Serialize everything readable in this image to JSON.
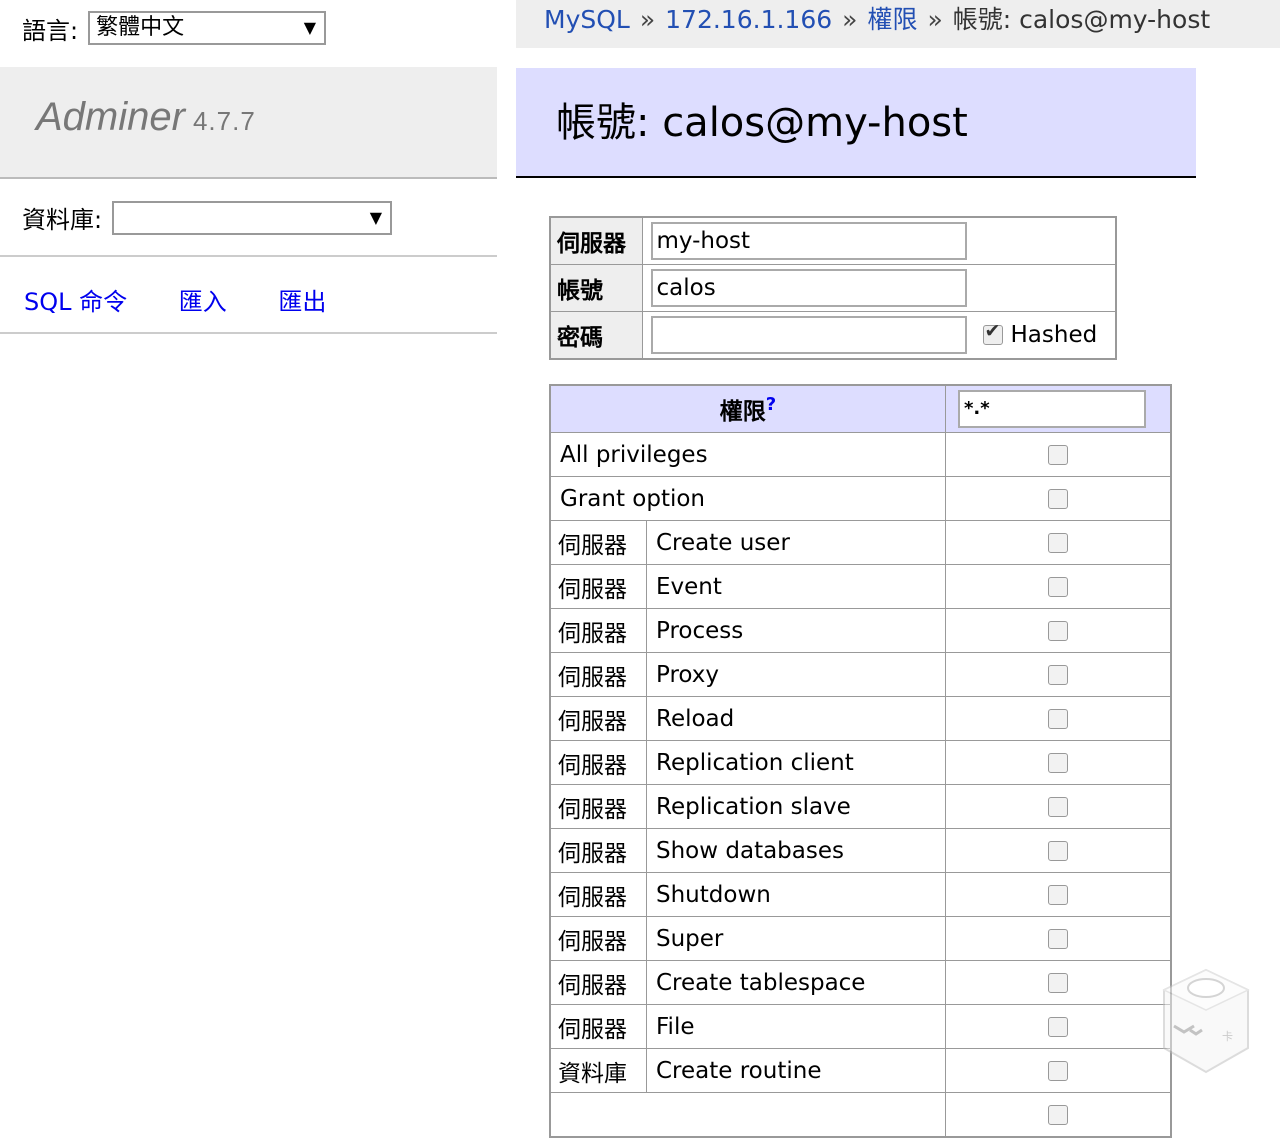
{
  "lang": {
    "label": "語言:",
    "selected": "繁體中文"
  },
  "logo": {
    "name": "Adminer",
    "version": "4.7.7"
  },
  "db_select": {
    "label": "資料庫:",
    "selected": ""
  },
  "links": {
    "sql": "SQL 命令",
    "import": "匯入",
    "export": "匯出"
  },
  "breadcrumb": {
    "driver": "MySQL",
    "server": "172.16.1.166",
    "privileges": "權限",
    "current": "帳號: calos@my-host",
    "separator": "»"
  },
  "page_title": "帳號: calos@my-host",
  "account": {
    "server_label": "伺服器",
    "server_value": "my-host",
    "user_label": "帳號",
    "user_value": "calos",
    "password_label": "密碼",
    "password_value": "",
    "hashed_label": "Hashed",
    "hashed_checked": true
  },
  "grants": {
    "header": "權限",
    "help": "?",
    "object_value": "*.*",
    "rows": [
      {
        "context": "",
        "privilege": "All privileges",
        "checked": false
      },
      {
        "context": "",
        "privilege": "Grant option",
        "checked": false
      },
      {
        "context": "伺服器",
        "privilege": "Create user",
        "checked": false
      },
      {
        "context": "伺服器",
        "privilege": "Event",
        "checked": false
      },
      {
        "context": "伺服器",
        "privilege": "Process",
        "checked": false
      },
      {
        "context": "伺服器",
        "privilege": "Proxy",
        "checked": false
      },
      {
        "context": "伺服器",
        "privilege": "Reload",
        "checked": false
      },
      {
        "context": "伺服器",
        "privilege": "Replication client",
        "checked": false
      },
      {
        "context": "伺服器",
        "privilege": "Replication slave",
        "checked": false
      },
      {
        "context": "伺服器",
        "privilege": "Show databases",
        "checked": false
      },
      {
        "context": "伺服器",
        "privilege": "Shutdown",
        "checked": false
      },
      {
        "context": "伺服器",
        "privilege": "Super",
        "checked": false
      },
      {
        "context": "伺服器",
        "privilege": "Create tablespace",
        "checked": false
      },
      {
        "context": "伺服器",
        "privilege": "File",
        "checked": false
      },
      {
        "context": "資料庫",
        "privilege": "Create routine",
        "checked": false
      },
      {
        "context": "",
        "privilege": "",
        "checked": false
      }
    ]
  },
  "icons": {
    "dropdown": "chevron-down-icon",
    "check": "check-icon",
    "watermark": "robot-logo-icon"
  }
}
